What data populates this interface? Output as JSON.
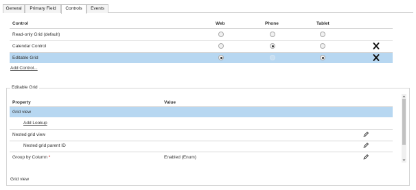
{
  "tabs": [
    {
      "label": "General"
    },
    {
      "label": "Primary Field"
    },
    {
      "label": "Controls"
    },
    {
      "label": "Events"
    }
  ],
  "controls": {
    "headers": {
      "control": "Control",
      "web": "Web",
      "phone": "Phone",
      "tablet": "Tablet"
    },
    "rows": [
      {
        "label": "Read-only Grid (default)",
        "web": false,
        "phone": false,
        "tablet": false,
        "removable": false
      },
      {
        "label": "Calendar Control",
        "web": false,
        "phone": true,
        "tablet": false,
        "removable": true
      },
      {
        "label": "Editable Grid",
        "web": true,
        "phone": false,
        "tablet": true,
        "removable": true,
        "selected": true
      }
    ],
    "add_link": "Add Control..."
  },
  "editable_grid": {
    "group_title": "Editable Grid",
    "headers": {
      "property": "Property",
      "value": "Value"
    },
    "rows": [
      {
        "label": "Grid view",
        "value": "",
        "selected": true
      },
      {
        "label": "Add Lookup",
        "value": "",
        "link": true
      },
      {
        "label": "Nested grid view",
        "value": "",
        "editable": true
      },
      {
        "label": "Nested grid parent ID",
        "value": "",
        "editable": true
      },
      {
        "label": "Group by Column",
        "required_marker": "*",
        "value": "Enabled (Enum)",
        "editable": true
      }
    ],
    "footer_label": "Grid view"
  },
  "colors": {
    "selected_row": "#b7d7f1",
    "required_marker": "#c00000",
    "border": "#d6d6d6"
  },
  "icons": {
    "remove": "close-x-icon",
    "edit": "pencil-icon",
    "scroll_up": "scroll-up-arrow-icon",
    "scroll_down": "scroll-down-arrow-icon"
  }
}
